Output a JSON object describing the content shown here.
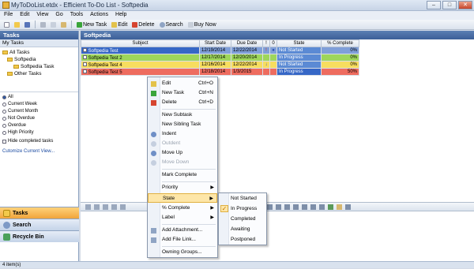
{
  "window": {
    "title": "MyToDoList.etdx - Efficient To-Do List - Softpedia"
  },
  "menu": [
    "File",
    "Edit",
    "View",
    "Go",
    "Tools",
    "Actions",
    "Help"
  ],
  "toolbar": {
    "new_task": "New Task",
    "edit": "Edit",
    "delete": "Delete",
    "search": "Search",
    "buy_now": "Buy Now"
  },
  "left": {
    "header": "Tasks",
    "subheader": "My Tasks",
    "tree": {
      "all_tasks": "All Tasks",
      "softpedia": "Softpedia",
      "softpedia_task": "Softpedia Task",
      "other_tasks": "Other Tasks"
    },
    "filters": [
      "All",
      "Current Week",
      "Current Month",
      "Not Overdue",
      "Overdue",
      "High Priority"
    ],
    "hide_completed": "Hide completed tasks",
    "customize": "Cutomize Current View...",
    "nav": {
      "tasks": "Tasks",
      "search": "Search",
      "recycle": "Recycle Bin"
    }
  },
  "grid": {
    "title": "Softpedia",
    "columns": [
      "Subject",
      "Start Date",
      "Due Date",
      "!",
      "0",
      "State",
      "% Complete"
    ],
    "rows": [
      {
        "subject": "Softpedia Test",
        "start": "12/19/2014",
        "due": "12/22/2014",
        "priority": "!",
        "att": "●",
        "state": "Not Started",
        "pct": "0%"
      },
      {
        "subject": "Softpedia Test 2",
        "start": "12/17/2014",
        "due": "12/20/2014",
        "priority": "",
        "att": "",
        "state": "In Progress",
        "pct": "0%"
      },
      {
        "subject": "Softpedia Test 4",
        "start": "12/16/2014",
        "due": "12/22/2014",
        "priority": "↓",
        "att": "",
        "state": "Not Started",
        "pct": "0%"
      },
      {
        "subject": "Softpedia Test 5",
        "start": "12/18/2014",
        "due": "1/3/2015",
        "priority": "",
        "att": "",
        "state": "In Progress",
        "pct": "50%"
      }
    ]
  },
  "context_menu": {
    "edit": "Edit",
    "edit_sc": "Ctrl+O",
    "new_task": "New Task",
    "new_task_sc": "Ctrl+N",
    "delete": "Delete",
    "delete_sc": "Ctrl+D",
    "new_subtask": "New Subtask",
    "new_sibling": "New Sibling Task",
    "indent": "Indent",
    "outdent": "Outdent",
    "move_up": "Move Up",
    "move_down": "Move Down",
    "mark_complete": "Mark Complete",
    "priority": "Priority",
    "state": "State",
    "pct_complete": "% Complete",
    "label": "Label",
    "add_attachment": "Add Attachment...",
    "add_file_link": "Add File Link...",
    "owning_groups": "Owning Groups..."
  },
  "state_submenu": [
    "Not Started",
    "In Progress",
    "Completed",
    "Awaiting",
    "Postponed"
  ],
  "status": {
    "items": "4 item(s)"
  }
}
